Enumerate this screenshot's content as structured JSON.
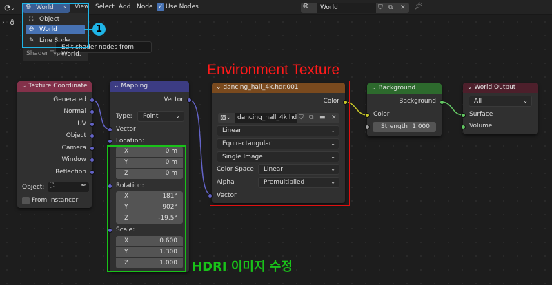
{
  "topbar": {
    "editor_type_icon": "node-editor-icon",
    "shader_type": "World",
    "menus": [
      "View",
      "Select",
      "Add",
      "Node"
    ],
    "use_nodes_label": "Use Nodes",
    "use_nodes_checked": true,
    "world_name": "World"
  },
  "shader_type_menu": {
    "items": [
      {
        "label": "Object",
        "icon": "object-icon"
      },
      {
        "label": "World",
        "icon": "world-icon",
        "selected": true
      },
      {
        "label": "Line Style",
        "icon": "linestyle-icon"
      }
    ],
    "tooltip": "Edit shader nodes from World.",
    "footer": "Shader Type",
    "callout_number": "1",
    "callout_color": "#1fb4e6"
  },
  "annotations": {
    "env_texture_title": "Environment Texture",
    "env_texture_color": "#ff1a1a",
    "hdri_label": "HDRI 이미지 수정",
    "hdri_color": "#19c219"
  },
  "nodes": {
    "texture_coordinate": {
      "title": "Texture Coordinate",
      "header_color": "#83314a",
      "outputs": [
        "Generated",
        "Normal",
        "UV",
        "Object",
        "Camera",
        "Window",
        "Reflection"
      ],
      "object_label": "Object:",
      "from_instancer_label": "From Instancer"
    },
    "mapping": {
      "title": "Mapping",
      "header_color": "#3c3c83",
      "output": "Vector",
      "type_label": "Type:",
      "type_value": "Point",
      "vector_input": "Vector",
      "location": {
        "label": "Location:",
        "x": "0 m",
        "y": "0 m",
        "z": "0 m"
      },
      "rotation": {
        "label": "Rotation:",
        "x": "181°",
        "y": "902°",
        "z": "-19.5°"
      },
      "scale": {
        "label": "Scale:",
        "x": "0.600",
        "y": "1.300",
        "z": "1.000"
      },
      "axes": [
        "X",
        "Y",
        "Z"
      ]
    },
    "environment_texture": {
      "title": "dancing_hall_4k.hdr.001",
      "header_color": "#7a4a1e",
      "output": "Color",
      "image_name": "dancing_hall_4k.hd...",
      "interpolation": "Linear",
      "projection": "Equirectangular",
      "source": "Single Image",
      "color_space_label": "Color Space",
      "color_space": "Linear",
      "alpha_label": "Alpha",
      "alpha": "Premultiplied",
      "vector_input": "Vector"
    },
    "background": {
      "title": "Background",
      "header_color": "#2d6a2d",
      "output": "Background",
      "color_input": "Color",
      "strength_label": "Strength",
      "strength_value": "1.000"
    },
    "world_output": {
      "title": "World Output",
      "header_color": "#4d1f2b",
      "target": "All",
      "surface": "Surface",
      "volume": "Volume"
    }
  }
}
